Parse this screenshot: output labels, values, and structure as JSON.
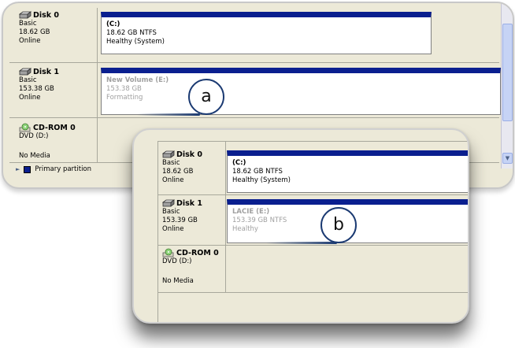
{
  "panel_a": {
    "disk0": {
      "name": "Disk 0",
      "type": "Basic",
      "size": "18.62 GB",
      "status": "Online"
    },
    "disk0_partition": {
      "title": "(C:)",
      "fs": "18.62 GB NTFS",
      "health": "Healthy (System)"
    },
    "disk1": {
      "name": "Disk 1",
      "type": "Basic",
      "size": "153.38 GB",
      "status": "Online"
    },
    "disk1_partition": {
      "title": "New Volume  (E:)",
      "size": "153.38 GB",
      "state": "Formatting"
    },
    "cdrom": {
      "name": "CD-ROM 0",
      "drive": "DVD (D:)",
      "media": "No Media"
    },
    "legend": {
      "label": "Primary partition",
      "color": "#0a1f8f"
    },
    "callout": "a"
  },
  "panel_b": {
    "disk0": {
      "name": "Disk 0",
      "type": "Basic",
      "size": "18.62 GB",
      "status": "Online"
    },
    "disk0_partition": {
      "title": "(C:)",
      "fs": "18.62 GB NTFS",
      "health": "Healthy (System)"
    },
    "disk1": {
      "name": "Disk 1",
      "type": "Basic",
      "size": "153.39 GB",
      "status": "Online"
    },
    "disk1_partition": {
      "title": "LACIE  (E:)",
      "fs": "153.39 GB NTFS",
      "health": "Healthy"
    },
    "cdrom": {
      "name": "CD-ROM 0",
      "drive": "DVD (D:)",
      "media": "No Media"
    },
    "callout": "b"
  },
  "icons": {
    "disk": "hard-disk-icon",
    "cdrom": "cdrom-icon"
  },
  "colors": {
    "partition_header": "#0a1f8f",
    "panel_bg": "#ece9d8",
    "callout_border": "#1b3a72"
  }
}
